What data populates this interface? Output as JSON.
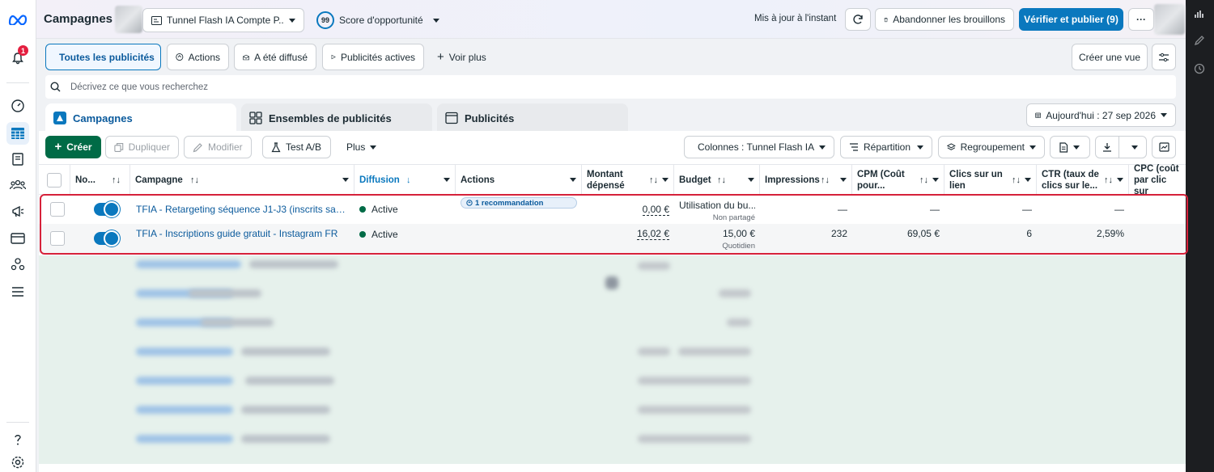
{
  "app": {
    "logo": "meta-logo-icon",
    "title": "Campagnes",
    "notifications_count": "1"
  },
  "header": {
    "account_name": "Tunnel Flash IA Compte P...",
    "opportunity_score": "99",
    "opportunity_label": "Score d'opportunité",
    "sync_status": "Mis à jour à l'instant",
    "discard_drafts": "Abandonner les brouillons",
    "review_publish": "Vérifier et publier (9)",
    "more": "···"
  },
  "filters": {
    "all_ads": "Toutes les publicités",
    "actions": "Actions",
    "delivered": "A été diffusé",
    "active_ads": "Publicités actives",
    "see_more": "Voir plus",
    "create_view": "Créer une vue"
  },
  "search": {
    "placeholder": "Décrivez ce que vous recherchez"
  },
  "level_tabs": {
    "campaigns": "Campagnes",
    "adsets": "Ensembles de publicités",
    "ads": "Publicités"
  },
  "date_range": "Aujourd'hui : 27 sep 2026",
  "toolbar": {
    "create": "Créer",
    "duplicate": "Dupliquer",
    "edit": "Modifier",
    "ab_test": "Test A/B",
    "more": "Plus",
    "columns": "Colonnes : Tunnel Flash IA",
    "breakdown": "Répartition",
    "grouping": "Regroupement"
  },
  "table": {
    "headers": {
      "name": "No...",
      "campaign": "Campagne",
      "delivery": "Diffusion",
      "actions": "Actions",
      "spent": "Montant dépensé",
      "budget": "Budget",
      "impressions": "Impressions",
      "cpm": "CPM (Coût pour...",
      "clicks": "Clics sur un lien",
      "ctr": "CTR (taux de clics sur le...",
      "cpc": "CPC (coût par clic sur"
    },
    "rows": [
      {
        "name": "TFIA - Retargeting séquence J1-J3 (inscrits sans a...",
        "delivery": "Active",
        "actions": "1 recommandation",
        "spent": "0,00 €",
        "budget": "Utilisation du bu...",
        "budget_sub": "Non partagé",
        "impressions": "—",
        "cpm": "—",
        "clicks": "—",
        "ctr": "—",
        "cpc": ""
      },
      {
        "name": "TFIA - Inscriptions guide gratuit - Instagram FR",
        "delivery": "Active",
        "actions": "",
        "spent": "16,02 €",
        "budget": "15,00 €",
        "budget_sub": "Quotidien",
        "impressions": "232",
        "cpm": "69,05 €",
        "clicks": "6",
        "ctr": "2,59%",
        "cpc": ""
      }
    ]
  },
  "colors": {
    "accent": "#0a78be",
    "active_green": "#006b46",
    "highlight_red": "#d6213a",
    "notification_red": "#e41e3f"
  }
}
